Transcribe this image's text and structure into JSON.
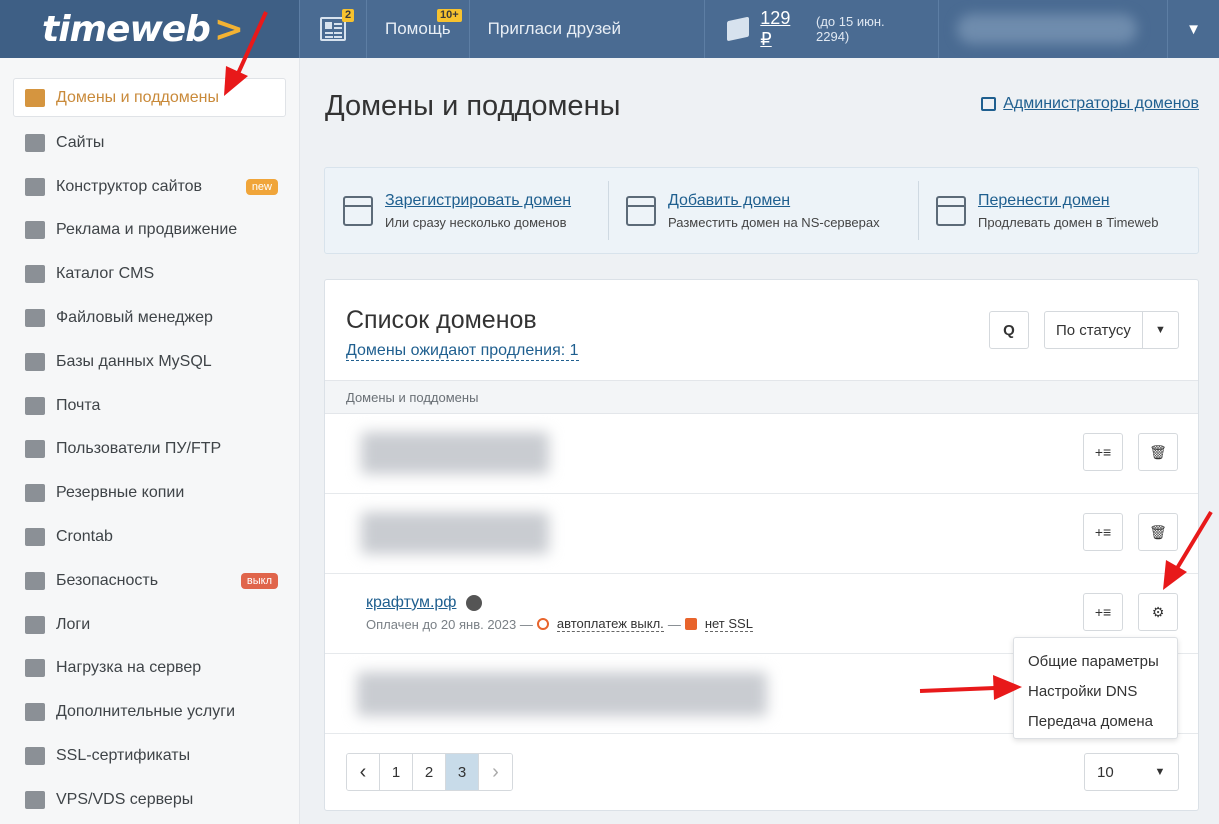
{
  "header": {
    "logo_text": "timeweb",
    "logo_chevron": ">",
    "news_badge": "2",
    "help_label": "Помощь",
    "help_badge": "10+",
    "invite_label": "Пригласи друзей",
    "balance": "129 ₽",
    "balance_until": "(до 15 июн. 2294)",
    "caret": "▼"
  },
  "sidebar": {
    "items": [
      {
        "label": "Домены и поддомены",
        "icon": "sitemap-icon"
      },
      {
        "label": "Сайты",
        "icon": "browser-gear-icon"
      },
      {
        "label": "Конструктор сайтов",
        "icon": "basket-icon",
        "pill": "new"
      },
      {
        "label": "Реклама и продвижение",
        "icon": "trend-chart-icon"
      },
      {
        "label": "Каталог CMS",
        "icon": "briefcase-icon"
      },
      {
        "label": "Файловый менеджер",
        "icon": "folder-icon"
      },
      {
        "label": "Базы данных MySQL",
        "icon": "database-icon"
      },
      {
        "label": "Почта",
        "icon": "mailbox-icon"
      },
      {
        "label": "Пользователи ПУ/FTP",
        "icon": "users-icon"
      },
      {
        "label": "Резервные копии",
        "icon": "server-icon"
      },
      {
        "label": "Crontab",
        "icon": "document-clock-icon"
      },
      {
        "label": "Безопасность",
        "icon": "shield-icon",
        "pill": "выкл"
      },
      {
        "label": "Логи",
        "icon": "document-check-icon"
      },
      {
        "label": "Нагрузка на сервер",
        "icon": "bar-chart-icon"
      },
      {
        "label": "Дополнительные услуги",
        "icon": "badge-check-icon"
      },
      {
        "label": "SSL-сертификаты",
        "icon": "certificate-icon"
      },
      {
        "label": "VPS/VDS серверы",
        "icon": "vps-server-icon"
      }
    ]
  },
  "main": {
    "title": "Домены и поддомены",
    "admins_link": "Администраторы доменов",
    "actions": [
      {
        "title": "Зарегистрировать домен",
        "subtitle": "Или сразу несколько доменов",
        "icon": "browser-plus-icon"
      },
      {
        "title": "Добавить домен",
        "subtitle": "Разместить домен на NS-серверах",
        "icon": "browser-link-icon"
      },
      {
        "title": "Перенести домен",
        "subtitle": "Продлевать домен в Timeweb",
        "icon": "browser-arrow-icon"
      }
    ],
    "list": {
      "title": "Список доменов",
      "pending_link": "Домены ожидают продления: 1",
      "search_label": "Q",
      "status_filter": "По статусу",
      "column_header": "Домены и поддомены",
      "domain": {
        "name": "крафтум.рф",
        "paid_until": "Оплачен до 20 янв. 2023 —",
        "autopay": "автоплатеж выкл.",
        "separator": "—",
        "ssl": "нет SSL"
      },
      "pagination": {
        "prev": "‹",
        "pages": [
          "1",
          "2",
          "3"
        ],
        "current": "3",
        "next": "›"
      },
      "per_page": "10"
    },
    "gear_menu": [
      "Общие параметры",
      "Настройки DNS",
      "Передача домена"
    ]
  },
  "colors": {
    "topbar": "#4a6b92",
    "accent_orange": "#d5953f",
    "link": "#1f5f8f",
    "pill_new": "#f0a53a",
    "pill_off": "#e0654b",
    "annotation_red": "#e8191a"
  }
}
